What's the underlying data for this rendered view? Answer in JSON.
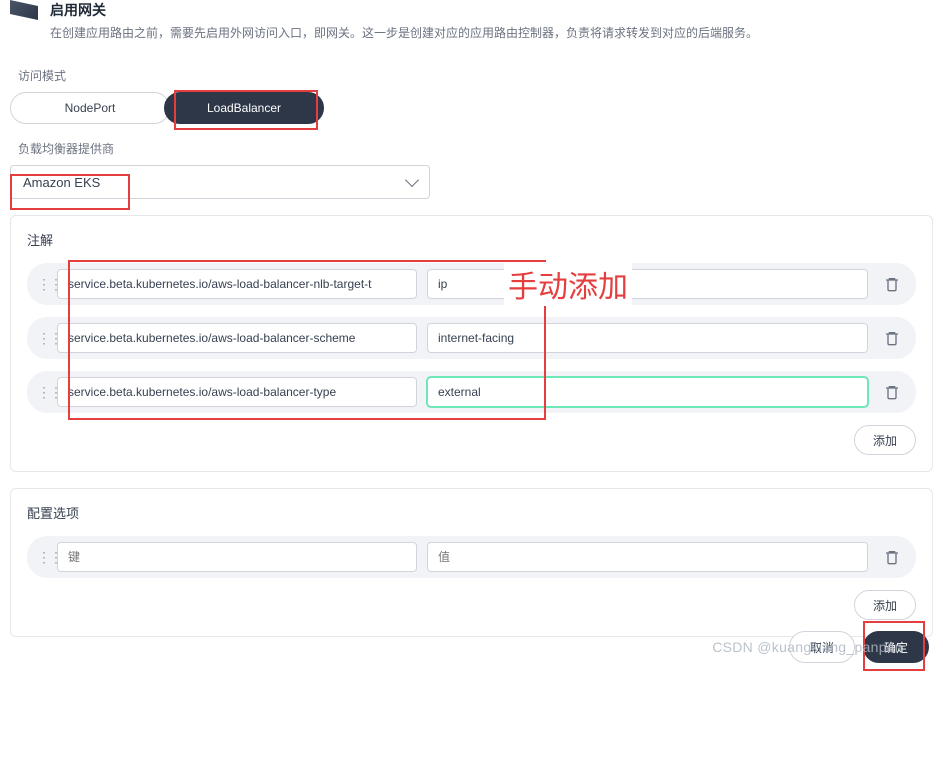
{
  "header": {
    "title": "启用网关",
    "desc": "在创建应用路由之前，需要先启用外网访问入口，即网关。这一步是创建对应的应用路由控制器，负责将请求转发到对应的后端服务。"
  },
  "access_mode": {
    "label": "访问模式",
    "tabs": [
      "NodePort",
      "LoadBalancer"
    ],
    "active": 1
  },
  "provider": {
    "label": "负载均衡器提供商",
    "value": "Amazon EKS"
  },
  "annotations": {
    "title": "注解",
    "rows": [
      {
        "key": "service.beta.kubernetes.io/aws-load-balancer-nlb-target-t",
        "value": "ip",
        "focus": false
      },
      {
        "key": "service.beta.kubernetes.io/aws-load-balancer-scheme",
        "value": "internet-facing",
        "focus": false
      },
      {
        "key": "service.beta.kubernetes.io/aws-load-balancer-type",
        "value": "external",
        "focus": true
      }
    ],
    "add_label": "添加"
  },
  "config": {
    "title": "配置选项",
    "key_placeholder": "键",
    "value_placeholder": "值",
    "add_label": "添加"
  },
  "footer": {
    "cancel": "取消",
    "confirm": "确定"
  },
  "overlay": {
    "manual_add": "手动添加",
    "watermark": "CSDN @kuangxiang_panpan"
  }
}
